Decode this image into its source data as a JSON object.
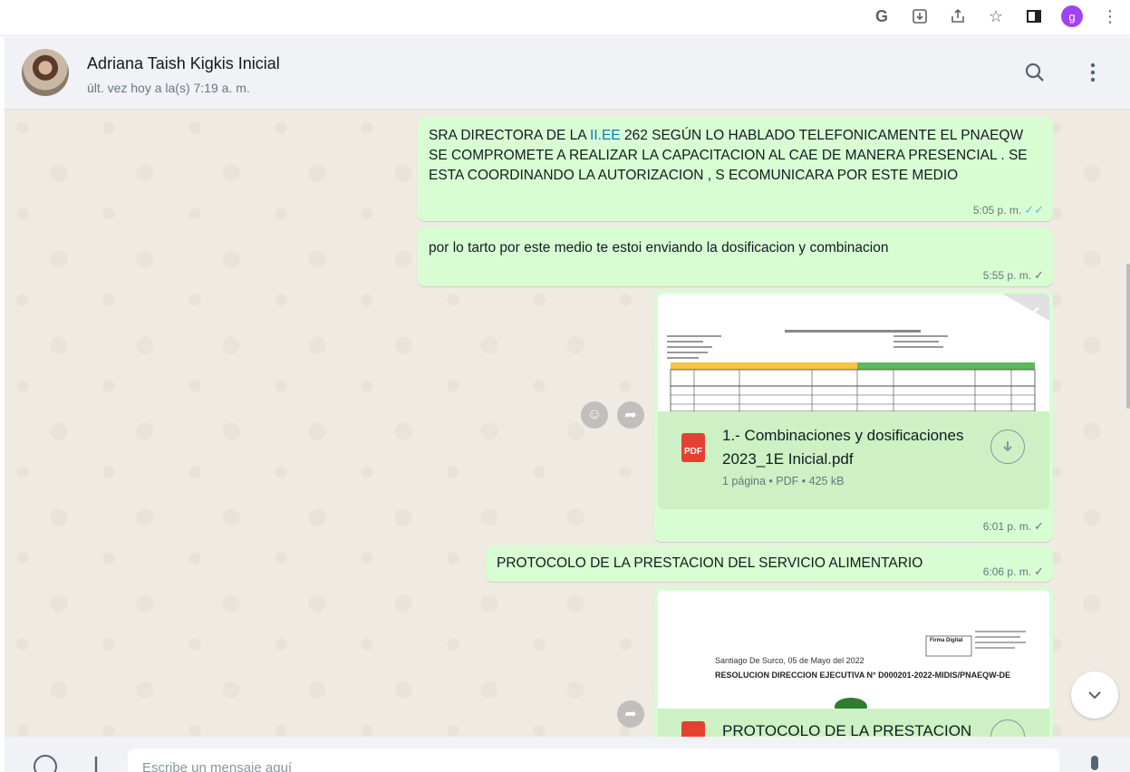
{
  "browser": {
    "google_glyph": "G",
    "profile_initial": "g",
    "icons": [
      "google-lens-icon",
      "install-app-icon",
      "share-icon",
      "star-icon",
      "side-panel-icon",
      "profile-icon",
      "kebab-menu-icon"
    ]
  },
  "header": {
    "contact_name": "Adriana Taish Kigkis Inicial",
    "last_seen": "últ. vez hoy a la(s) 7:19 a. m."
  },
  "messages": [
    {
      "id": "m1",
      "text_pre": "SRA  DIRECTORA   DE LA ",
      "link": "II.EE",
      "text_post": " 262  SEGÚN LO HABLADO TELEFONICAMENTE  EL PNAEQW  SE COMPROMETE A  REALIZAR LA CAPACITACION AL CAE  DE MANERA PRESENCIAL . SE ESTA COORDINANDO LA AUTORIZACION , S ECOMUNICARA POR ESTE MEDIO",
      "time": "5:05 p. m.",
      "status": "read"
    },
    {
      "id": "m2",
      "text": "por lo tarto por este medio te estoi enviando la dosificacion y combinacion",
      "time": "5:55 p. m.",
      "status": "sent"
    },
    {
      "id": "m3",
      "type": "document",
      "file_badge": "PDF",
      "file_name": "1.- Combinaciones y dosificaciones 2023_1E Inicial.pdf",
      "meta": "1 página • PDF • 425 kB",
      "time": "6:01 p. m.",
      "status": "sent"
    },
    {
      "id": "m4",
      "text": "PROTOCOLO DE LA PRESTACION DEL SERVICIO ALIMENTARIO",
      "time": "6:06 p. m.",
      "status": "sent"
    },
    {
      "id": "m5",
      "type": "document",
      "preview_line1": "Santiago De Surco, 05 de Mayo del 2022",
      "preview_line2": "RESOLUCION DIRECCION EJECUTIVA N°   D000201-2022-MIDIS/PNAEQW-DE",
      "preview_stamp": "Firma Digital",
      "file_name": "PROTOCOLO DE LA PRESTACION"
    }
  ],
  "composer": {
    "placeholder": "Escribe un mensaje aquí"
  }
}
